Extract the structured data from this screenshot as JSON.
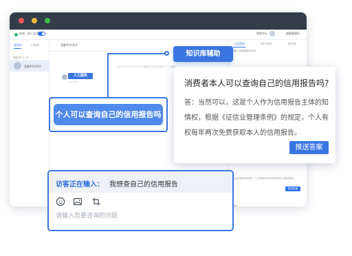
{
  "topbar": {
    "status": "在线",
    "status_sub": "接入会话",
    "help": "帮助中心",
    "user_name": "超级管理员"
  },
  "left_panel": {
    "tab_active": "会话中",
    "tab_inactive": "已结束",
    "queue_label": "排队中 1 / 2",
    "visitor_name": "游客#5A7EA"
  },
  "chat": {
    "title": "游客#5A7EA",
    "join_note": "2023-11-07 14:32:05 游客#5A7EA 已接入人工客服",
    "agent_tag": "人工服务",
    "agent_sub": "14:32:05"
  },
  "right_panel": {
    "tabs": [
      "人员资料",
      "用户资料",
      "知识库"
    ],
    "search": "请输入你要搜索的内容",
    "snippet": "征信业管理条例的规定，个人有权每年两次免费获取本人的信用报告。",
    "button": "推送答案",
    "bottom_label": "一级"
  },
  "callout": {
    "kb_label": "知识库辅助",
    "question": "个人可以查询自己的信用报告吗",
    "card_question": "消费者本人可以查询自己的信用报告吗?",
    "card_answer": "答：当然可以，这是个人作为信用报告主体的知情权，根据《征信业管理条例》的规定，个人有权每年两次免费获取本人的信用报告。",
    "push_button": "推送答案"
  },
  "input": {
    "typing_label": "访客正在输入：",
    "typing_text": "我想查自己的信用报告",
    "placeholder": "请输入您要咨询的问题",
    "icons": [
      "emoji-icon",
      "image-icon",
      "screenshot-icon"
    ]
  },
  "colors": {
    "accent": "#3a76e2",
    "titlebar": "#343d4a",
    "traffic_red": "#ee5a52",
    "traffic_yellow": "#f3b93b",
    "traffic_green": "#3cc04a"
  }
}
